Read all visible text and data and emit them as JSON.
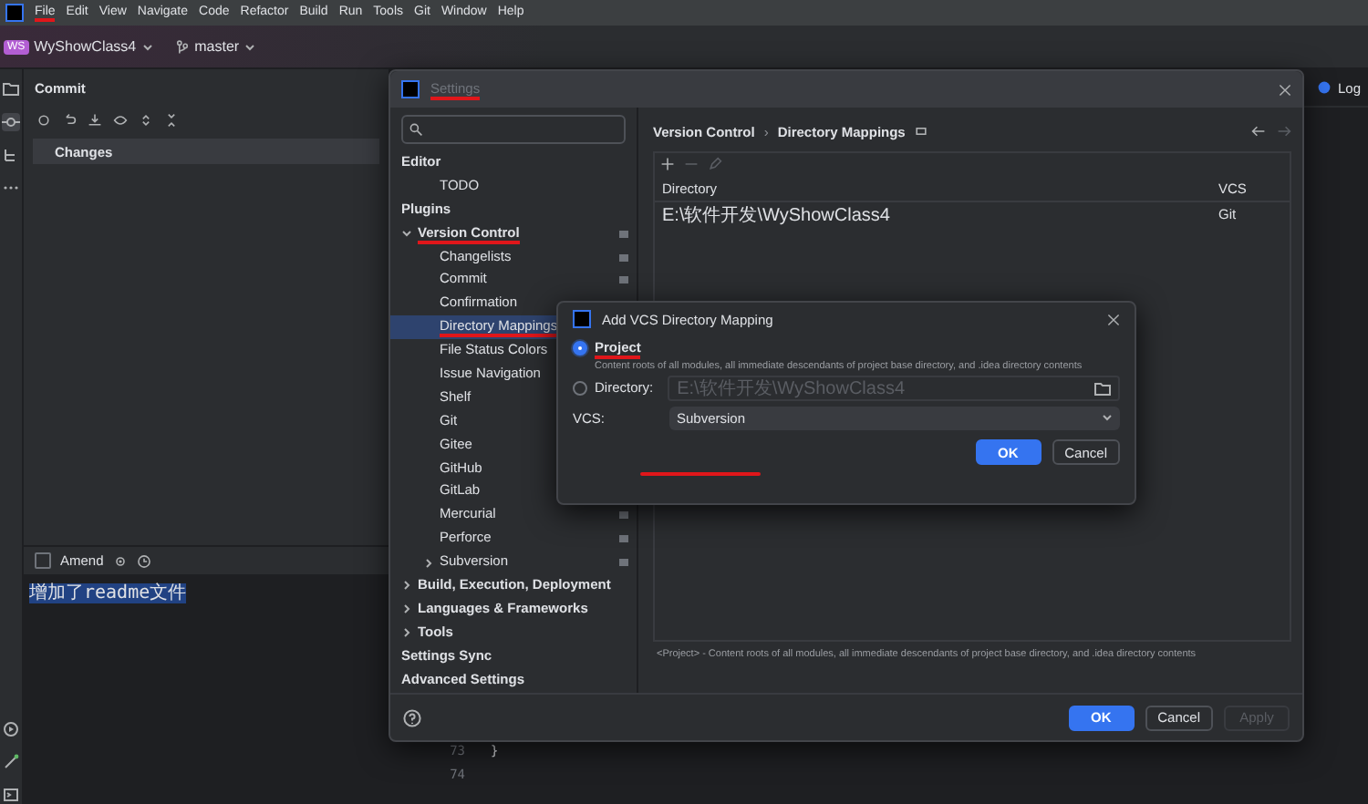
{
  "menu_bar": {
    "items": [
      {
        "label": "File",
        "annotated": true
      },
      {
        "label": "Edit",
        "annotated": false
      },
      {
        "label": "View",
        "annotated": false
      },
      {
        "label": "Navigate",
        "annotated": false
      },
      {
        "label": "Code",
        "annotated": false
      },
      {
        "label": "Refactor",
        "annotated": false
      },
      {
        "label": "Build",
        "annotated": false
      },
      {
        "label": "Run",
        "annotated": false
      },
      {
        "label": "Tools",
        "annotated": false
      },
      {
        "label": "Git",
        "annotated": false
      },
      {
        "label": "Window",
        "annotated": false
      },
      {
        "label": "Help",
        "annotated": false
      }
    ]
  },
  "toolbar": {
    "project_badge": "WS",
    "project": "WyShowClass4",
    "branch": "master"
  },
  "commit_panel": {
    "title": "Commit",
    "changes_label": "Changes",
    "amend": {
      "label": "Amend",
      "checked": false
    },
    "message": "增加了readme文件"
  },
  "editor": {
    "tab": "Log",
    "lines": [
      {
        "number": "73",
        "code": "}"
      },
      {
        "number": "74"
      }
    ]
  },
  "settings_dialog": {
    "title": "Settings",
    "title_annotated": true,
    "tree": [
      {
        "label": "Editor",
        "kind": "group",
        "selected": false,
        "annotated": false,
        "project_level": false,
        "children": [
          {
            "label": "TODO",
            "selected": false,
            "annotated": false,
            "project_level": false
          }
        ]
      },
      {
        "label": "Plugins",
        "kind": "leaf",
        "selected": false,
        "annotated": false,
        "project_level": false
      },
      {
        "label": "Version Control",
        "kind": "folder",
        "expanded": true,
        "selected": false,
        "annotated": true,
        "project_level": true,
        "children": [
          {
            "label": "Changelists",
            "selected": false,
            "annotated": false,
            "project_level": true
          },
          {
            "label": "Commit",
            "selected": false,
            "annotated": false,
            "project_level": true
          },
          {
            "label": "Confirmation",
            "selected": false,
            "annotated": false
          },
          {
            "label": "Directory Mappings",
            "selected": true,
            "annotated": true
          },
          {
            "label": "File Status Colors",
            "selected": false,
            "annotated": false
          },
          {
            "label": "Issue Navigation",
            "selected": false,
            "annotated": false
          },
          {
            "label": "Shelf",
            "selected": false,
            "annotated": false
          },
          {
            "label": "Git",
            "selected": false,
            "annotated": false
          },
          {
            "label": "Gitee",
            "selected": false,
            "annotated": false
          },
          {
            "label": "GitHub",
            "selected": false,
            "annotated": false
          },
          {
            "label": "GitLab",
            "selected": false,
            "annotated": false
          },
          {
            "label": "Mercurial",
            "selected": false,
            "annotated": false,
            "project_level": true
          },
          {
            "label": "Perforce",
            "selected": false,
            "annotated": false,
            "project_level": true
          },
          {
            "label": "Subversion",
            "kind": "folder",
            "expanded": false,
            "selected": false,
            "annotated": false,
            "project_level": true
          }
        ]
      },
      {
        "label": "Build, Execution, Deployment",
        "kind": "folder",
        "expanded": false,
        "selected": false,
        "annotated": false,
        "project_level": false
      },
      {
        "label": "Languages & Frameworks",
        "kind": "folder",
        "expanded": false,
        "selected": false,
        "annotated": false,
        "project_level": false
      },
      {
        "label": "Tools",
        "kind": "folder",
        "expanded": false,
        "selected": false,
        "annotated": false,
        "project_level": false
      },
      {
        "label": "Settings Sync",
        "kind": "leaf",
        "selected": false,
        "annotated": false,
        "project_level": false
      },
      {
        "label": "Advanced Settings",
        "kind": "leaf",
        "selected": false,
        "annotated": false,
        "project_level": false
      }
    ],
    "breadcrumb": [
      "Version Control",
      "Directory Mappings"
    ],
    "breadcrumb_separator": "›",
    "table": {
      "columns": [
        "Directory",
        "VCS"
      ],
      "rows": [
        [
          "E:\\软件开发\\WyShowClass4",
          "Git"
        ]
      ]
    },
    "note": "<Project> - Content roots of all modules, all immediate descendants of project base directory, and .idea directory contents",
    "buttons": [
      {
        "label": "OK",
        "kind": "primary",
        "disabled": false
      },
      {
        "label": "Cancel",
        "kind": "normal",
        "disabled": false
      },
      {
        "label": "Apply",
        "kind": "normal",
        "disabled": true
      }
    ]
  },
  "mapping_dialog": {
    "title": "Add VCS Directory Mapping",
    "options": [
      {
        "label": "Project",
        "selected": true,
        "annotated": true,
        "description": "Content roots of all modules, all immediate descendants of project base directory, and .idea directory contents"
      },
      {
        "label": "Directory:",
        "selected": false,
        "annotated": false,
        "path": "E:\\软件开发\\WyShowClass4",
        "disabled": true
      }
    ],
    "vcs_label": "VCS:",
    "vcs_value": "Subversion",
    "vcs_annotated": true,
    "buttons": [
      {
        "label": "OK",
        "kind": "primary",
        "disabled": false
      },
      {
        "label": "Cancel",
        "kind": "normal",
        "disabled": false
      }
    ]
  }
}
